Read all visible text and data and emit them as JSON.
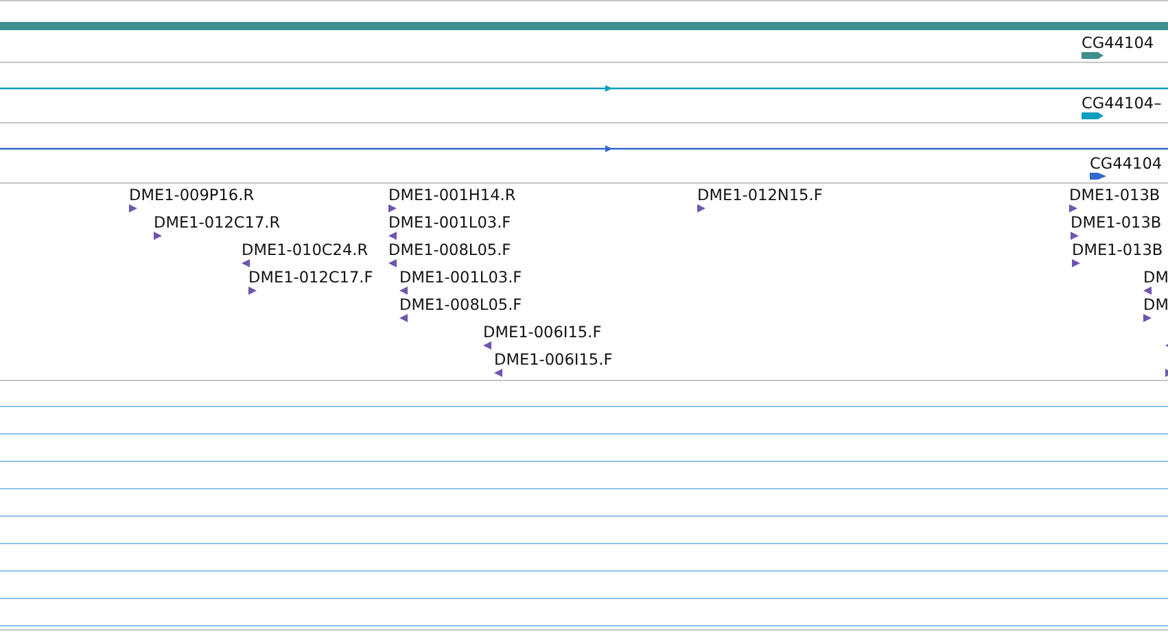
{
  "gene_tracks": [
    {
      "kind": "gene",
      "label": "CG44104",
      "color": "#3f8f8f",
      "reverse": false
    },
    {
      "kind": "transcript",
      "label": "CG44104–",
      "color": "#0b9cc0",
      "reverse": false
    },
    {
      "kind": "transcript",
      "label": "CG44104",
      "color": "#2f68d0",
      "reverse": false
    }
  ],
  "est_track": {
    "features": [
      {
        "label": "DME1-009P16.R",
        "reverse": false
      },
      {
        "label": "DME1-001H14.R",
        "reverse": false
      },
      {
        "label": "DME1-012N15.F",
        "reverse": false
      },
      {
        "label": "DME1-013B",
        "reverse": false
      },
      {
        "label": "DME1-012C17.R",
        "reverse": false
      },
      {
        "label": "DME1-001L03.F",
        "reverse": true
      },
      {
        "label": "DME1-013B",
        "reverse": false
      },
      {
        "label": "DME1-010C24.R",
        "reverse": true
      },
      {
        "label": "DME1-008L05.F",
        "reverse": true
      },
      {
        "label": "DME1-013B",
        "reverse": false
      },
      {
        "label": "DME1-012C17.F",
        "reverse": false
      },
      {
        "label": "DME1-001L03.F",
        "reverse": true
      },
      {
        "label": "DM",
        "reverse": true
      },
      {
        "label": "DME1-008L05.F",
        "reverse": true
      },
      {
        "label": "DM",
        "reverse": false
      },
      {
        "label": "DME1-006I15.F",
        "reverse": true
      },
      {
        "reverse": true
      },
      {
        "label": "DME1-006I15.F",
        "reverse": true
      },
      {
        "reverse": false
      }
    ]
  }
}
